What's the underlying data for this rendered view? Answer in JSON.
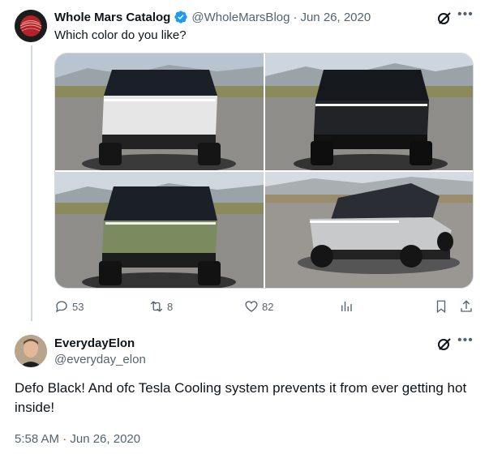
{
  "tweet": {
    "author_name": "Whole Mars Catalog",
    "handle": "@WholeMarsBlog",
    "separator": "·",
    "date": "Jun 26, 2020",
    "text": "Which color do you like?",
    "media": [
      {
        "description": "cybertruck-white-front",
        "body_color": "#e8e8e8"
      },
      {
        "description": "cybertruck-black-front",
        "body_color": "#1f1f22"
      },
      {
        "description": "cybertruck-green-front",
        "body_color": "#7b8a5f"
      },
      {
        "description": "cybertruck-silver-angle",
        "body_color": "#c8c9cb"
      }
    ],
    "stats": {
      "replies": "53",
      "retweets": "8",
      "likes": "82"
    }
  },
  "reply": {
    "author_name": "EverydayElon",
    "handle": "@everyday_elon",
    "text": "Defo Black! And ofc Tesla Cooling system prevents it from ever getting hot inside!",
    "timestamp": "5:58 AM · Jun 26, 2020"
  },
  "colors": {
    "text_primary": "#0f1419",
    "text_secondary": "#536471",
    "border": "#cfd9de",
    "verified": "#1d9bf0"
  },
  "icons": {
    "verified": "verified-badge-icon",
    "grok": "grok-icon",
    "more": "more-horizontal-icon",
    "reply": "reply-icon",
    "retweet": "retweet-icon",
    "like": "heart-icon",
    "views": "analytics-icon",
    "bookmark": "bookmark-icon",
    "share": "share-icon"
  }
}
